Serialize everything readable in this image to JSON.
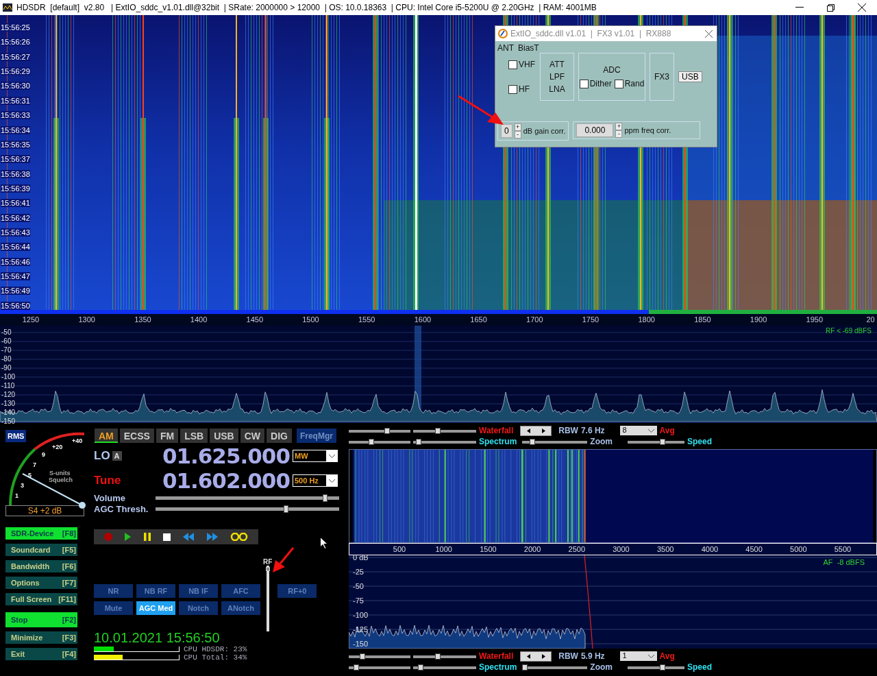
{
  "window": {
    "title": "HDSDR  [default]  v2.80   | ExtIO_sddc_v1.01.dll@32bit  | SRate: 2000000 > 12000  | OS: 10.0.18363  | CPU: Intel Core i5-5200U @ 2.20GHz  | RAM: 4001MB"
  },
  "waterfall": {
    "timestamps": [
      "15:56:25",
      "15:56:26",
      "15:56:27",
      "15:56:29",
      "15:56:30",
      "15:56:31",
      "15:56:33",
      "15:56:34",
      "15:56:35",
      "15:56:37",
      "15:56:38",
      "15:56:39",
      "15:56:41",
      "15:56:42",
      "15:56:43",
      "15:56:44",
      "15:56:46",
      "15:56:47",
      "15:56:49",
      "15:56:50"
    ]
  },
  "rf_scale": {
    "labels": [
      "1250",
      "1300",
      "1350",
      "1400",
      "1450",
      "1500",
      "1550",
      "1600",
      "1650",
      "1700",
      "1750",
      "1800",
      "1850",
      "1900",
      "1950",
      "20"
    ]
  },
  "rf_spectrum": {
    "y_labels": [
      "-50",
      "-60",
      "-70",
      "-80",
      "-90",
      "-100",
      "-110",
      "-120",
      "-130",
      "-140",
      "-150"
    ],
    "status": "RF < -69 dBFS"
  },
  "extio_dialog": {
    "title": "ExtIO_sddc.dll v1.01  |  FX3 v1.01  |  RX888",
    "ant_label": "ANT",
    "biast_label": "BiasT",
    "inputs": [
      {
        "label": "VHF",
        "checked": false
      },
      {
        "label": "HF",
        "checked": false
      }
    ],
    "frontend": [
      "ATT",
      "LPF",
      "LNA"
    ],
    "adc_label": "ADC",
    "adc_options": [
      {
        "label": "Dither",
        "checked": false
      },
      {
        "label": "Rand",
        "checked": false
      }
    ],
    "fx3_label": "FX3",
    "usb_button": "USB",
    "gain": {
      "value": "0",
      "plus": "+",
      "minus": "-",
      "label": "dB gain corr."
    },
    "ppm": {
      "value": "0.000",
      "plus": "+",
      "minus": "-",
      "label": "ppm freq corr."
    }
  },
  "s_meter": {
    "mode_button": "RMS",
    "scale_labels": [
      "+40",
      "+20",
      "9",
      "7",
      "5",
      "3",
      "1"
    ],
    "caption_1": "S-units",
    "caption_2": "Squelch",
    "reading": "S4 +2 dB"
  },
  "function_buttons": [
    {
      "label": "SDR-Device",
      "key": "[F8]",
      "on": true
    },
    {
      "label": "Soundcard",
      "key": "[F5]",
      "on": false
    },
    {
      "label": "Bandwidth",
      "key": "[F6]",
      "on": false
    },
    {
      "label": "Options",
      "key": "[F7]",
      "on": false
    },
    {
      "label": "Full Screen",
      "key": "[F11]",
      "on": false
    },
    {
      "label": "Stop",
      "key": "[F2]",
      "on": true
    },
    {
      "label": "Minimize",
      "key": "[F3]",
      "on": false
    },
    {
      "label": "Exit",
      "key": "[F4]",
      "on": false
    }
  ],
  "modes": [
    {
      "label": "AM",
      "selected": true
    },
    {
      "label": "ECSS",
      "selected": false
    },
    {
      "label": "FM",
      "selected": false
    },
    {
      "label": "LSB",
      "selected": false
    },
    {
      "label": "USB",
      "selected": false
    },
    {
      "label": "CW",
      "selected": false
    },
    {
      "label": "DIG",
      "selected": false
    }
  ],
  "freq_manager": "FreqMgr",
  "lo": {
    "label": "LO",
    "badge": "A",
    "frequency": "01.625.000",
    "band": "MW"
  },
  "tune": {
    "label": "Tune",
    "frequency": "01.602.000",
    "bandwidth": "500 Hz"
  },
  "volume": {
    "label": "Volume",
    "level": 0.94
  },
  "agc_thresh": {
    "label": "AGC Thresh.",
    "level": 0.72
  },
  "rf_gain": {
    "label": "RF",
    "level": 0.98
  },
  "dsp_buttons": [
    {
      "label": "NR",
      "selected": false
    },
    {
      "label": "NB RF",
      "selected": false
    },
    {
      "label": "NB IF",
      "selected": false
    },
    {
      "label": "AFC",
      "selected": false
    },
    {
      "label": "Mute",
      "selected": false
    },
    {
      "label": "AGC Med",
      "selected": true
    },
    {
      "label": "Notch",
      "selected": false
    },
    {
      "label": "ANotch",
      "selected": false
    }
  ],
  "rf_zero_button": "RF+0",
  "clock": "10.01.2021 15:56:50",
  "cpu": [
    {
      "text": "CPU HDSDR: 23%",
      "level": 0.23,
      "color": "#00e000"
    },
    {
      "text": "CPU Total: 34%",
      "level": 0.34,
      "color": "#f0f000"
    }
  ],
  "af_top_bar": {
    "waterfall_sliders": [
      {
        "level": 0.63
      },
      {
        "level": 0.38
      }
    ],
    "spectrum_sliders": [
      {
        "level": 0.35
      },
      {
        "level": 0.05
      }
    ],
    "zoom_slider": {
      "level": 0.12
    },
    "speed_slider": {
      "level": 0.62
    },
    "waterfall_label": "Waterfall",
    "spectrum_label": "Spectrum",
    "rbw_label": "RBW",
    "rbw": "7.6 Hz",
    "avg": "8",
    "avg_label": "Avg",
    "zoom_label": "Zoom",
    "speed_label": "Speed"
  },
  "af_scale": {
    "labels": [
      "500",
      "1000",
      "1500",
      "2000",
      "2500",
      "3000",
      "3500",
      "4000",
      "4500",
      "5000",
      "5500"
    ]
  },
  "af_spectrum": {
    "y_labels": [
      "0 dB",
      "-25",
      "-50",
      "-75",
      "-100",
      "-125",
      "-150"
    ],
    "status": "AF  -8 dBFS"
  },
  "af_bottom_bar": {
    "waterfall_sliders": [
      {
        "level": 0.2
      },
      {
        "level": 0.38
      }
    ],
    "spectrum_sliders": [
      {
        "level": 0.08
      },
      {
        "level": 0.08
      }
    ],
    "zoom_slider": {
      "level": 0.0
    },
    "speed_slider": {
      "level": 0.63
    },
    "waterfall_label": "Waterfall",
    "spectrum_label": "Spectrum",
    "rbw_label": "RBW",
    "rbw": "5.9 Hz",
    "avg": "1",
    "avg_label": "Avg",
    "zoom_label": "Zoom",
    "speed_label": "Speed"
  }
}
